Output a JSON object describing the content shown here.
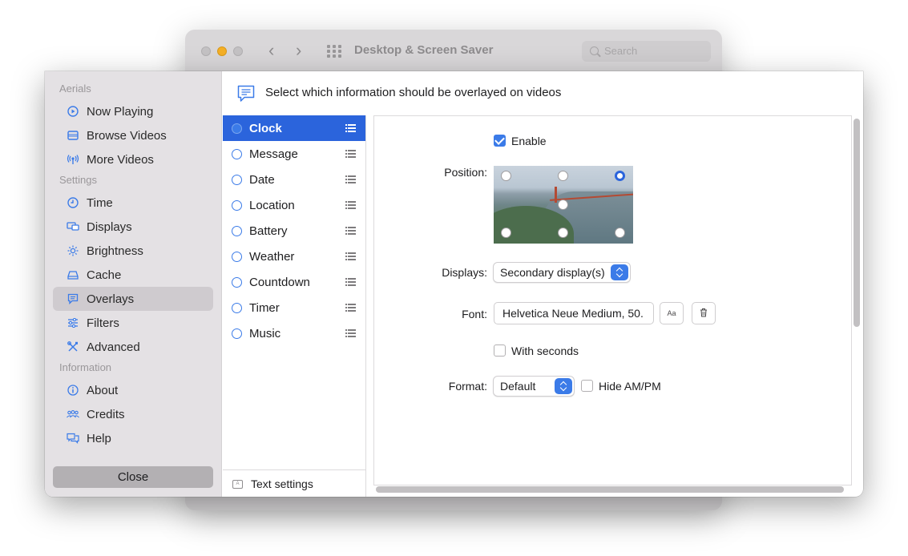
{
  "background_window": {
    "title": "Desktop & Screen Saver",
    "search_placeholder": "Search"
  },
  "sidebar": {
    "sections": [
      {
        "header": "Aerials",
        "items": [
          {
            "label": "Now Playing",
            "icon": "play-circle-icon"
          },
          {
            "label": "Browse Videos",
            "icon": "film-icon"
          },
          {
            "label": "More Videos",
            "icon": "antenna-icon"
          }
        ]
      },
      {
        "header": "Settings",
        "items": [
          {
            "label": "Time",
            "icon": "clock-icon"
          },
          {
            "label": "Displays",
            "icon": "display-icon"
          },
          {
            "label": "Brightness",
            "icon": "sun-icon"
          },
          {
            "label": "Cache",
            "icon": "drive-icon"
          },
          {
            "label": "Overlays",
            "icon": "message-icon",
            "selected": true
          },
          {
            "label": "Filters",
            "icon": "sliders-icon"
          },
          {
            "label": "Advanced",
            "icon": "tools-icon"
          }
        ]
      },
      {
        "header": "Information",
        "items": [
          {
            "label": "About",
            "icon": "info-icon"
          },
          {
            "label": "Credits",
            "icon": "people-icon"
          },
          {
            "label": "Help",
            "icon": "help-bubble-icon"
          }
        ]
      }
    ],
    "close_label": "Close"
  },
  "header": {
    "text": "Select which information should be overlayed on videos"
  },
  "overlays": {
    "items": [
      "Clock",
      "Message",
      "Date",
      "Location",
      "Battery",
      "Weather",
      "Countdown",
      "Timer",
      "Music"
    ],
    "selected": "Clock",
    "text_settings_label": "Text settings"
  },
  "detail": {
    "enable_label": "Enable",
    "enable_checked": true,
    "position_label": "Position:",
    "position_selected": "top-right",
    "displays_label": "Displays:",
    "displays_value": "Secondary display(s)",
    "font_label": "Font:",
    "font_value": "Helvetica Neue Medium, 50.",
    "font_button_label": "Aa",
    "with_seconds_label": "With seconds",
    "with_seconds_checked": false,
    "format_label": "Format:",
    "format_value": "Default",
    "hide_ampm_label": "Hide AM/PM",
    "hide_ampm_checked": false
  },
  "colors": {
    "accent": "#3b7be8",
    "selection": "#2b64dc",
    "sidebar_bg": "#e4e1e4"
  }
}
